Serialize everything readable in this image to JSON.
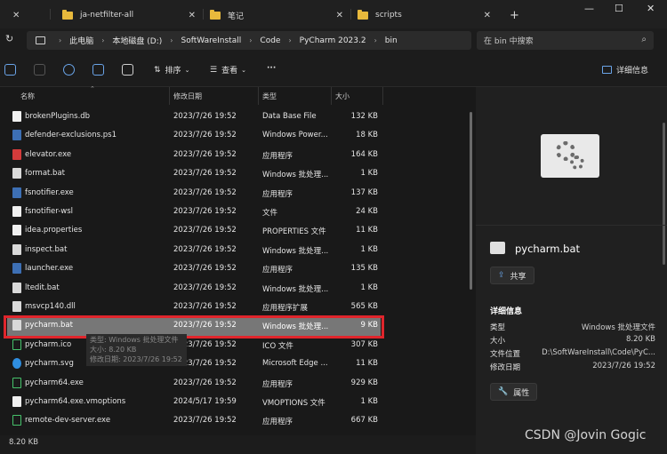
{
  "tabs": [
    {
      "label": "ja-netfilter-all"
    },
    {
      "label": "笔记"
    },
    {
      "label": "scripts"
    }
  ],
  "window_controls": {
    "minimize": "—",
    "maximize": "☐",
    "close": "✕"
  },
  "breadcrumb": [
    "此电脑",
    "本地磁盘 (D:)",
    "SoftWareInstall",
    "Code",
    "PyCharm 2023.2",
    "bin"
  ],
  "search": {
    "placeholder": "在 bin 中搜索"
  },
  "toolbar": {
    "sort_label": "排序",
    "view_label": "查看",
    "more_label": "···",
    "details_label": "详细信息"
  },
  "columns": {
    "name": "名称",
    "date": "修改日期",
    "type": "类型",
    "size": "大小"
  },
  "files": [
    {
      "name": "brokenPlugins.db",
      "date": "2023/7/26 19:52",
      "type": "Data Base File",
      "size": "132 KB",
      "icon": "file-icon"
    },
    {
      "name": "defender-exclusions.ps1",
      "date": "2023/7/26 19:52",
      "type": "Windows Power...",
      "size": "18 KB",
      "icon": "script-icon"
    },
    {
      "name": "elevator.exe",
      "date": "2023/7/26 19:52",
      "type": "应用程序",
      "size": "164 KB",
      "icon": "exe-icon"
    },
    {
      "name": "format.bat",
      "date": "2023/7/26 19:52",
      "type": "Windows 批处理...",
      "size": "1 KB",
      "icon": "batch-icon"
    },
    {
      "name": "fsnotifier.exe",
      "date": "2023/7/26 19:52",
      "type": "应用程序",
      "size": "137 KB",
      "icon": "exe-icon"
    },
    {
      "name": "fsnotifier-wsl",
      "date": "2023/7/26 19:52",
      "type": "文件",
      "size": "24 KB",
      "icon": "file-icon"
    },
    {
      "name": "idea.properties",
      "date": "2023/7/26 19:52",
      "type": "PROPERTIES 文件",
      "size": "11 KB",
      "icon": "file-icon"
    },
    {
      "name": "inspect.bat",
      "date": "2023/7/26 19:52",
      "type": "Windows 批处理...",
      "size": "1 KB",
      "icon": "batch-icon"
    },
    {
      "name": "launcher.exe",
      "date": "2023/7/26 19:52",
      "type": "应用程序",
      "size": "135 KB",
      "icon": "exe-icon"
    },
    {
      "name": "ltedit.bat",
      "date": "2023/7/26 19:52",
      "type": "Windows 批处理...",
      "size": "1 KB",
      "icon": "batch-icon"
    },
    {
      "name": "msvcp140.dll",
      "date": "2023/7/26 19:52",
      "type": "应用程序扩展",
      "size": "565 KB",
      "icon": "dll-icon"
    },
    {
      "name": "pycharm.bat",
      "date": "2023/7/26 19:52",
      "type": "Windows 批处理...",
      "size": "9 KB",
      "icon": "batch-icon"
    },
    {
      "name": "pycharm.ico",
      "date": "2023/7/26 19:52",
      "type": "ICO 文件",
      "size": "307 KB",
      "icon": "pycharm-icon"
    },
    {
      "name": "pycharm.svg",
      "date": "2023/7/26 19:52",
      "type": "Microsoft Edge ...",
      "size": "11 KB",
      "icon": "edge-icon"
    },
    {
      "name": "pycharm64.exe",
      "date": "2023/7/26 19:52",
      "type": "应用程序",
      "size": "929 KB",
      "icon": "pycharm-icon"
    },
    {
      "name": "pycharm64.exe.vmoptions",
      "date": "2024/5/17 19:59",
      "type": "VMOPTIONS 文件",
      "size": "1 KB",
      "icon": "file-icon"
    },
    {
      "name": "remote-dev-server.exe",
      "date": "2023/7/26 19:52",
      "type": "应用程序",
      "size": "667 KB",
      "icon": "pycharm-icon"
    }
  ],
  "tooltip": {
    "line1": "类型: Windows 批处理文件",
    "line2": "大小: 8.20 KB",
    "line3": "修改日期: 2023/7/26 19:52"
  },
  "status": {
    "text": "8.20 KB"
  },
  "details": {
    "file_name": "pycharm.bat",
    "share_label": "共享",
    "section_title": "详细信息",
    "props": [
      {
        "key": "类型",
        "value": "Windows 批处理文件"
      },
      {
        "key": "大小",
        "value": "8.20 KB"
      },
      {
        "key": "文件位置",
        "value": "D:\\SoftWareInstall\\Code\\PyC..."
      },
      {
        "key": "修改日期",
        "value": "2023/7/26 19:52"
      }
    ],
    "properties_label": "属性"
  },
  "watermark": "CSDN @Jovin Gogic"
}
